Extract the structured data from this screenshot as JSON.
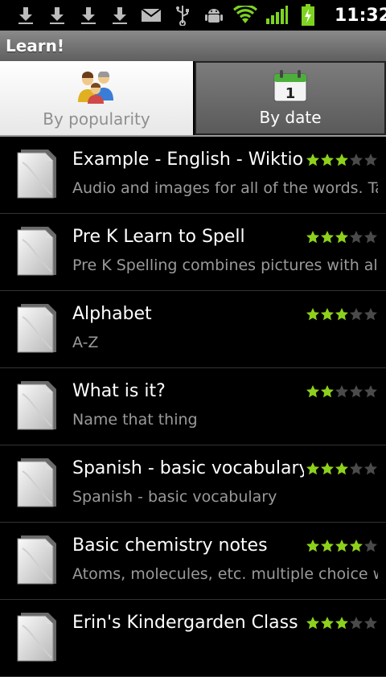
{
  "status_bar": {
    "time": "11:32",
    "icons": [
      "download-icon",
      "download-icon",
      "download-icon",
      "download-icon",
      "mail-icon",
      "usb-icon",
      "android-debug-icon",
      "wifi-icon",
      "signal-icon",
      "battery-charging-icon"
    ]
  },
  "app": {
    "title": "Learn!"
  },
  "tabs": [
    {
      "label": "By popularity",
      "icon": "people-icon",
      "selected": false
    },
    {
      "label": "By date",
      "icon": "calendar-icon",
      "calendar_day": "1",
      "selected": true
    }
  ],
  "items": [
    {
      "title": "Example - English - Wiktionary",
      "subtitle": "Audio and images for all of the words. Tak",
      "rating": 3
    },
    {
      "title": "Pre K Learn to Spell",
      "subtitle": "Pre K Spelling combines pictures with alpha",
      "rating": 3
    },
    {
      "title": "Alphabet",
      "subtitle": "A-Z",
      "rating": 3
    },
    {
      "title": "What is it?",
      "subtitle": "Name that thing",
      "rating": 2
    },
    {
      "title": "Spanish - basic vocabulary",
      "subtitle": "Spanish - basic vocabulary",
      "rating": 3
    },
    {
      "title": "Basic chemistry notes",
      "subtitle": "Atoms, molecules, etc. multiple choice wi",
      "rating": 4
    },
    {
      "title": "Erin's Kindergarden Class",
      "subtitle": "",
      "rating": 3
    }
  ],
  "colors": {
    "star_on": "#8ed11c",
    "star_off": "#4a4a4a"
  }
}
